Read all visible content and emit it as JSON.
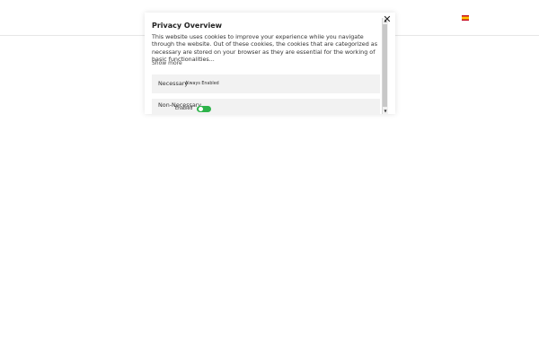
{
  "header": {
    "flag_icon": "spain-flag-icon"
  },
  "modal": {
    "title": "Privacy Overview",
    "description": "This website uses cookies to improve your experience while you navigate through the website. Out of these cookies, the cookies that are categorized as necessary are stored on your browser as they are essential for the working of basic functionalities...",
    "show_more": "Show more",
    "close_icon": "close-icon",
    "sections": {
      "necessary": {
        "label": "Necessary",
        "status": "Always Enabled"
      },
      "non_necessary": {
        "label": "Non-Necessary",
        "status": "Enabled",
        "toggle_on": true
      }
    }
  },
  "colors": {
    "toggle_on": "#2db34a",
    "section_bg": "#f2f2f2"
  }
}
